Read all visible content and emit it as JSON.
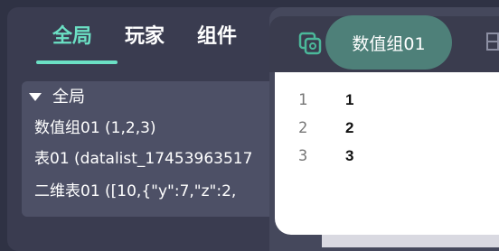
{
  "tabs": {
    "global": "全局",
    "player": "玩家",
    "component": "组件"
  },
  "tree": {
    "header": "全局",
    "items": [
      "数值组01 (1,2,3)",
      "表01 (datalist_17453963517",
      "二维表01 ([10,{\"y\":7,\"z\":2,"
    ]
  },
  "editor": {
    "active_chip": "数值组01",
    "rows": [
      {
        "index": "1",
        "value": "1"
      },
      {
        "index": "2",
        "value": "2"
      },
      {
        "index": "3",
        "value": "3"
      }
    ]
  },
  "colors": {
    "accent": "#6be0c4",
    "chip": "#4e8079",
    "panel": "#3a3c50",
    "tree_box": "#4d5066",
    "content": "#ffffff"
  },
  "icons": {
    "toolbar_left": "copy-icon",
    "toolbar_right": "partial-icon"
  }
}
